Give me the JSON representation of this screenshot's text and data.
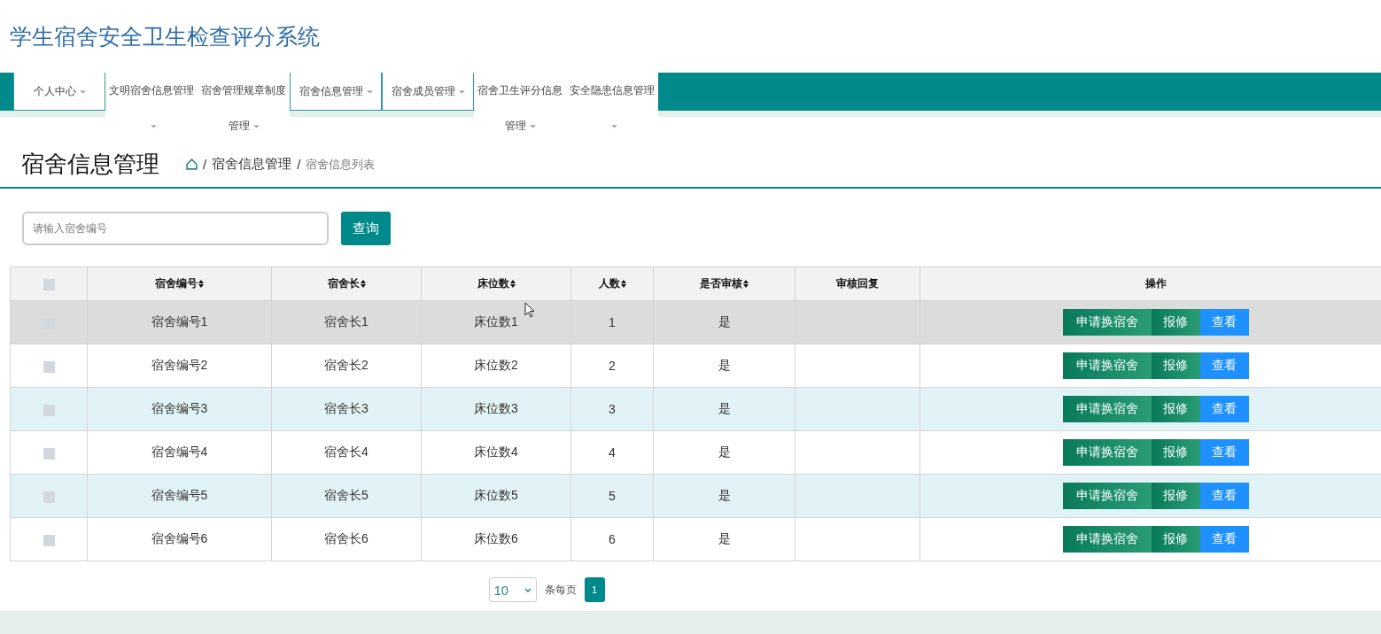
{
  "header": {
    "title": "学生宿舍安全卫生检查评分系统"
  },
  "nav": [
    {
      "label": "个人中心",
      "wraps": false
    },
    {
      "label": "文明宿舍信息管理",
      "wraps": true
    },
    {
      "label": "宿舍管理规章制度管理",
      "wraps": true
    },
    {
      "label": "宿舍信息管理",
      "wraps": false
    },
    {
      "label": "宿舍成员管理",
      "wraps": false
    },
    {
      "label": "宿舍卫生评分信息管理",
      "wraps": true
    },
    {
      "label": "安全隐患信息管理",
      "wraps": true
    }
  ],
  "page": {
    "title": "宿舍信息管理",
    "breadcrumb": [
      {
        "separator": "/",
        "label": "宿舍信息管理"
      },
      {
        "separator": "/",
        "label": "宿舍信息列表"
      }
    ]
  },
  "search": {
    "placeholder": "请输入宿舍编号",
    "button": "查询"
  },
  "table": {
    "select_all_checked": false,
    "columns": [
      {
        "label": "宿舍编号",
        "sortable": true
      },
      {
        "label": "宿舍长",
        "sortable": true
      },
      {
        "label": "床位数",
        "sortable": true
      },
      {
        "label": "人数",
        "sortable": true
      },
      {
        "label": "是否审核",
        "sortable": true
      },
      {
        "label": "审核回复",
        "sortable": false
      },
      {
        "label": "操作",
        "sortable": false
      }
    ],
    "rows": [
      {
        "checked": false,
        "hovered": true,
        "cells": [
          "宿舍编号1",
          "宿舍长1",
          "床位数1",
          "1",
          "是",
          ""
        ],
        "actions": [
          {
            "label": "申请换宿舍",
            "kind": "apply"
          },
          {
            "label": "报修",
            "kind": "repair"
          },
          {
            "label": "查看",
            "kind": "view"
          }
        ]
      },
      {
        "checked": false,
        "hovered": false,
        "cells": [
          "宿舍编号2",
          "宿舍长2",
          "床位数2",
          "2",
          "是",
          ""
        ],
        "actions": [
          {
            "label": "申请换宿舍",
            "kind": "apply"
          },
          {
            "label": "报修",
            "kind": "repair"
          },
          {
            "label": "查看",
            "kind": "view"
          }
        ]
      },
      {
        "checked": false,
        "hovered": false,
        "cells": [
          "宿舍编号3",
          "宿舍长3",
          "床位数3",
          "3",
          "是",
          ""
        ],
        "actions": [
          {
            "label": "申请换宿舍",
            "kind": "apply"
          },
          {
            "label": "报修",
            "kind": "repair"
          },
          {
            "label": "查看",
            "kind": "view"
          }
        ]
      },
      {
        "checked": false,
        "hovered": false,
        "cells": [
          "宿舍编号4",
          "宿舍长4",
          "床位数4",
          "4",
          "是",
          ""
        ],
        "actions": [
          {
            "label": "申请换宿舍",
            "kind": "apply"
          },
          {
            "label": "报修",
            "kind": "repair"
          },
          {
            "label": "查看",
            "kind": "view"
          }
        ]
      },
      {
        "checked": false,
        "hovered": false,
        "cells": [
          "宿舍编号5",
          "宿舍长5",
          "床位数5",
          "5",
          "是",
          ""
        ],
        "actions": [
          {
            "label": "申请换宿舍",
            "kind": "apply"
          },
          {
            "label": "报修",
            "kind": "repair"
          },
          {
            "label": "查看",
            "kind": "view"
          }
        ]
      },
      {
        "checked": false,
        "hovered": false,
        "cells": [
          "宿舍编号6",
          "宿舍长6",
          "床位数6",
          "6",
          "是",
          ""
        ],
        "actions": [
          {
            "label": "申请换宿舍",
            "kind": "apply"
          },
          {
            "label": "报修",
            "kind": "repair"
          },
          {
            "label": "查看",
            "kind": "view"
          }
        ]
      }
    ]
  },
  "pagination": {
    "page_size": "10",
    "per_page_label": "条每页",
    "pages": [
      {
        "label": "1",
        "selected": true
      }
    ]
  }
}
